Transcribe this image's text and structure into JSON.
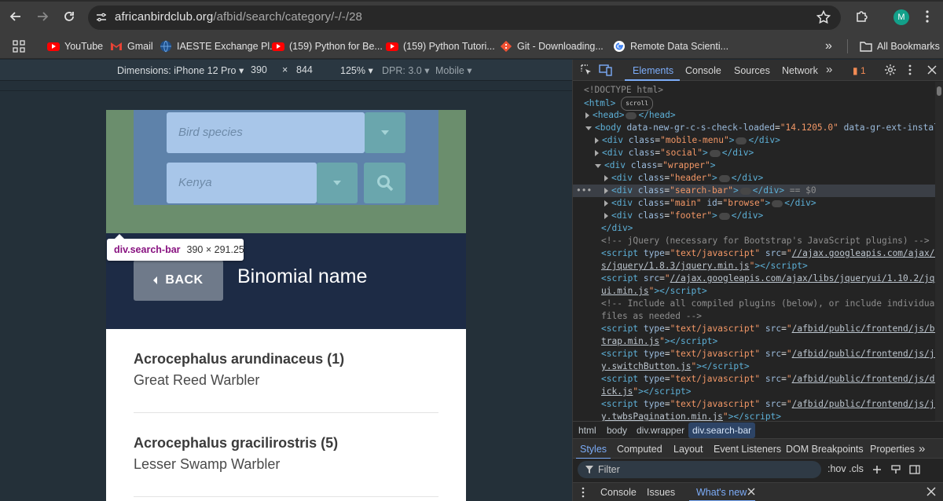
{
  "browser": {
    "url_domain": "africanbirdclub.org",
    "url_path": "/afbid/search/category/-/-/28",
    "avatar_letter": "M",
    "bookmarks": [
      {
        "label": "YouTube",
        "icon": "youtube-icon"
      },
      {
        "label": "Gmail",
        "icon": "gmail-icon"
      },
      {
        "label": "IAESTE Exchange Pl...",
        "icon": "globe-icon"
      },
      {
        "label": "(159) Python for Be...",
        "icon": "youtube-icon"
      },
      {
        "label": "(159) Python Tutori...",
        "icon": "youtube-icon"
      },
      {
        "label": "Git - Downloading...",
        "icon": "git-icon"
      },
      {
        "label": "Remote Data Scienti...",
        "icon": "google-icon"
      }
    ],
    "overflow_label": "»",
    "all_bookmarks": "All Bookmarks"
  },
  "device_toolbar": {
    "dimensions": "Dimensions: iPhone 12 Pro",
    "width": "390",
    "times": "×",
    "height": "844",
    "zoom": "125%",
    "dpr": "DPR: 3.0",
    "mode": "Mobile"
  },
  "page": {
    "species_placeholder": "Bird species",
    "country_placeholder": "Kenya",
    "tooltip_tag": "div.search-bar",
    "tooltip_size": "390 × 291.25",
    "back_label": "BACK",
    "heading": "Binomial name",
    "birds": [
      {
        "scientific": "Acrocephalus arundinaceus (1)",
        "common": "Great Reed Warbler"
      },
      {
        "scientific": "Acrocephalus gracilirostris (5)",
        "common": "Lesser Swamp Warbler"
      }
    ]
  },
  "devtools": {
    "tabs": [
      "Elements",
      "Console",
      "Sources",
      "Network"
    ],
    "more": "»",
    "issues_count": "1",
    "dom": {
      "doctype": "<!DOCTYPE html>",
      "html_open": "<html>",
      "scroll": "scroll",
      "head": "head",
      "head_close": "</head>",
      "body_attr1": "data-new-gr-c-s-check-loaded",
      "body_val1": "\"14.1205.0\"",
      "body_attr2": "data-gr-ext-installed",
      "div_mobile": "\"mobile-menu\"",
      "div_social": "\"social\"",
      "div_wrapper": "\"wrapper\"",
      "div_header": "\"header\"",
      "div_search": "\"search-bar\"",
      "sel_marker": "== $0",
      "div_main": "\"main\"",
      "main_id": "\"browse\"",
      "div_footer": "\"footer\"",
      "div_close": "</div>",
      "comment1": "<!-- jQuery (necessary for Bootstrap's JavaScript plugins) -->",
      "script1_src_a": "//ajax.googleapis.com/ajax/libs",
      "script1_src_b": "s/jquery/1.8.3/jquery.min.js",
      "script2_src_a": "//ajax.googleapis.com/ajax/libs/jqueryui/1.10.2/jquery-",
      "script2_src_b": "ui.min.js",
      "comment2_a": "<!-- Include all compiled plugins (below), or include individual",
      "comment2_b": "files as needed -->",
      "script3_src_a": "/afbid/public/frontend/js/boots",
      "script3_src_b": "trap.min.js",
      "script4_src_a": "/afbid/public/frontend/js/jquer",
      "script4_src_b": "y.switchButton.js",
      "script5_src_a": "/afbid/public/frontend/js/dropk",
      "script5_src_b": "ick.js",
      "script6_src_a": "/afbid/public/frontend/js/jquer",
      "script6_src_b": "y.twbsPagination.min.js"
    },
    "breadcrumbs": [
      "html",
      "body",
      "div.wrapper",
      "div.search-bar"
    ],
    "style_tabs": [
      "Styles",
      "Computed",
      "Layout",
      "Event Listeners",
      "DOM Breakpoints",
      "Properties"
    ],
    "filter_placeholder": "Filter",
    "filter_tools": ":hov .cls",
    "drawer_tabs": [
      "Console",
      "Issues",
      "What's new"
    ]
  }
}
